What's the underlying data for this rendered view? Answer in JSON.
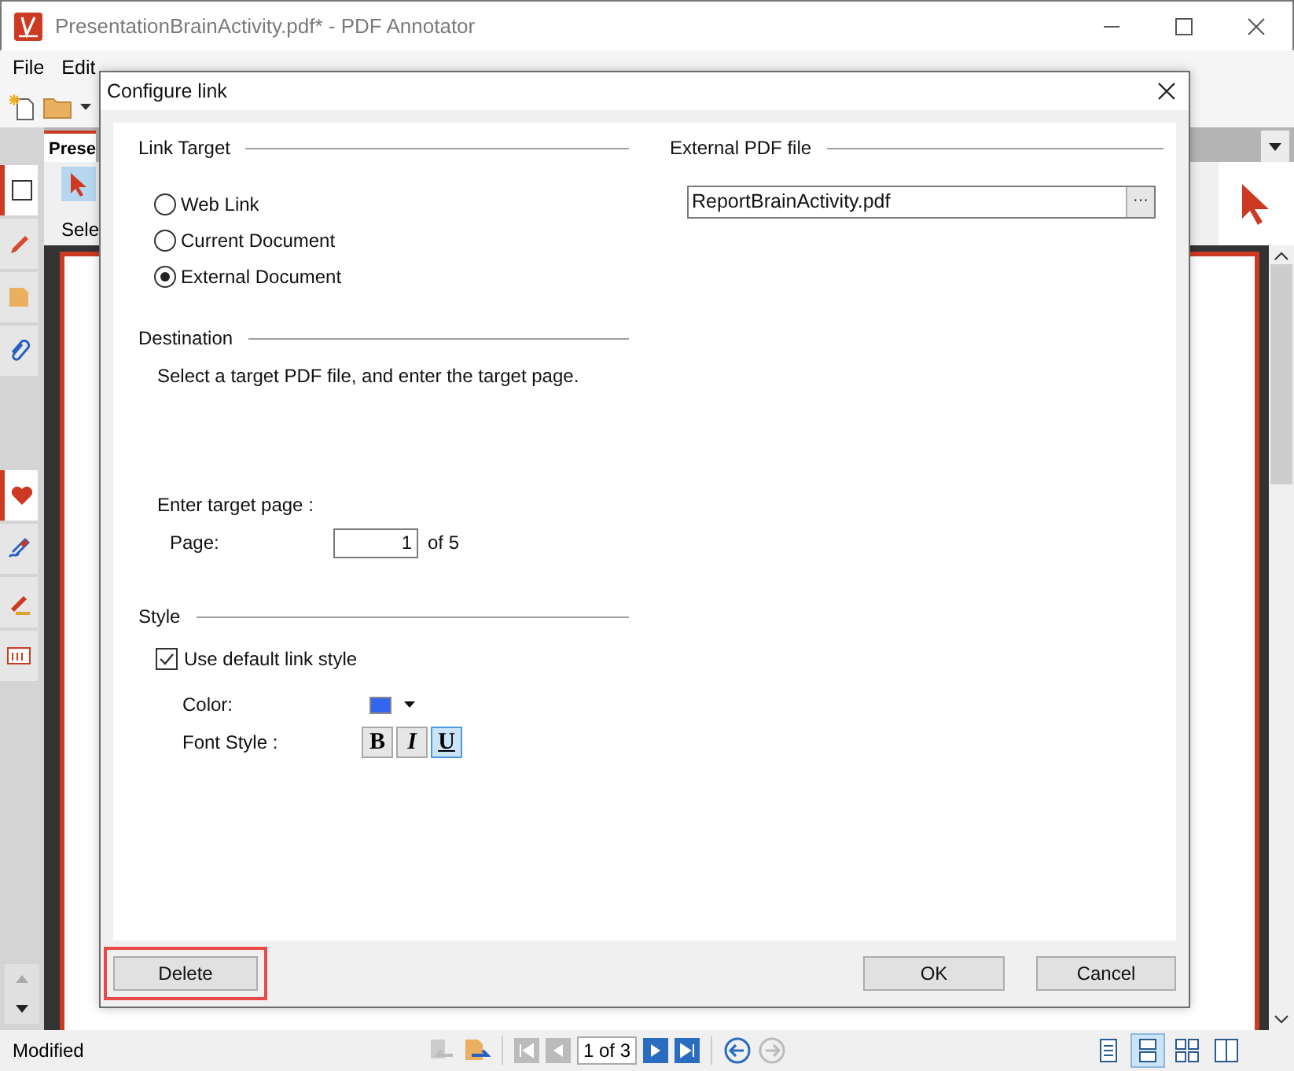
{
  "window": {
    "title": "PresentationBrainActivity.pdf* - PDF Annotator"
  },
  "menu": [
    "File",
    "Edit"
  ],
  "sidebar_tabs": [
    {
      "selected": true
    },
    {
      "selected": false
    },
    {
      "selected": false
    },
    {
      "selected": false
    }
  ],
  "sidebar_tabs_lower": [
    {
      "selected": true
    },
    {
      "selected": false
    },
    {
      "selected": false
    },
    {
      "selected": false
    }
  ],
  "document_tab": {
    "label": "Prese"
  },
  "tool_strip": {
    "label": "Sele"
  },
  "status_bar": {
    "text": "Modified",
    "page": "1 of 3",
    "view_modes": [
      {
        "selected": false
      },
      {
        "selected": true
      },
      {
        "selected": false
      },
      {
        "selected": false
      }
    ]
  },
  "dialog": {
    "title": "Configure link",
    "link_target": {
      "heading": "Link Target",
      "options": [
        {
          "label": "Web Link",
          "selected": false
        },
        {
          "label": "Current Document",
          "selected": false
        },
        {
          "label": "External Document",
          "selected": true
        }
      ]
    },
    "destination": {
      "heading": "Destination",
      "description": "Select a target PDF file, and enter the target page.",
      "prompt": "Enter target page :",
      "page_label": "Page:",
      "page_value": "1",
      "page_total": "of 5"
    },
    "style": {
      "heading": "Style",
      "use_default": {
        "label": "Use default link style",
        "checked": true
      },
      "color_label": "Color:",
      "color": "#3366ee",
      "font_style_label": "Font Style :",
      "font_styles": [
        {
          "label": "B",
          "kind": "bold",
          "selected": false
        },
        {
          "label": "I",
          "kind": "italic",
          "selected": false
        },
        {
          "label": "U",
          "kind": "underline",
          "selected": true
        }
      ]
    },
    "external_file": {
      "heading": "External PDF file",
      "value": "ReportBrainActivity.pdf",
      "browse": "···"
    },
    "buttons": [
      {
        "label": "Delete",
        "highlighted": true
      },
      {
        "label": "OK",
        "highlighted": false
      },
      {
        "label": "Cancel",
        "highlighted": false
      }
    ]
  }
}
